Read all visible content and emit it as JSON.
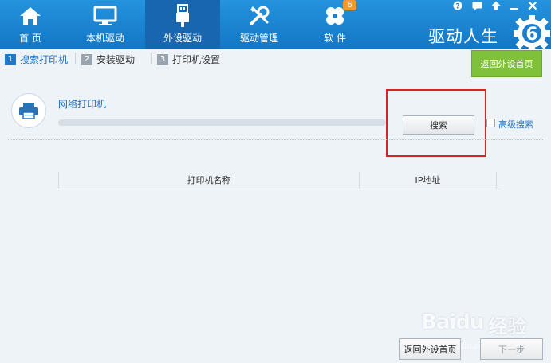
{
  "nav": {
    "tabs": [
      {
        "label": "首 页",
        "icon": "home-icon"
      },
      {
        "label": "本机驱动",
        "icon": "monitor-icon"
      },
      {
        "label": "外设驱动",
        "icon": "usb-icon",
        "active": true
      },
      {
        "label": "驱动管理",
        "icon": "tools-icon"
      },
      {
        "label": "软 件",
        "icon": "clover-icon"
      }
    ],
    "software_badge": "6"
  },
  "window_controls": [
    "help-icon",
    "message-icon",
    "upgrade-icon",
    "minimize-icon",
    "close-icon"
  ],
  "brand": {
    "title": "驱动人生",
    "logo_number": "6"
  },
  "steps": [
    {
      "num": "1",
      "label": "搜索打印机",
      "active": true
    },
    {
      "num": "2",
      "label": "安装驱动"
    },
    {
      "num": "3",
      "label": "打印机设置"
    }
  ],
  "return_top_button": "返回外设首页",
  "search": {
    "title": "网络打印机",
    "button_label": "搜索",
    "advanced_label": "高级搜索",
    "progress": 0
  },
  "table": {
    "columns": [
      "打印机名称",
      "IP地址"
    ]
  },
  "bottom": {
    "back_label": "返回外设首页",
    "next_label": "下一步"
  },
  "watermark": {
    "text": "Baidu",
    "sub": "经验",
    "url": "jingyan.baidu.com"
  },
  "colors": {
    "accent": "#1b7ad0",
    "topbar": "#1e88d8",
    "green_button": "#7fc13b",
    "highlight": "#d8232a"
  }
}
